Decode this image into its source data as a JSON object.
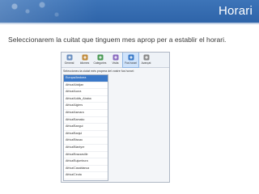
{
  "slide": {
    "title": "Horari",
    "subtitle": "Seleccionarem la cuitat que tinguem mes aprop per a establir el horari."
  },
  "screenshot": {
    "toolbar": {
      "buttons": [
        {
          "label": "General",
          "icon": "general-icon",
          "color": "#6a8fc0"
        },
        {
          "label": "Idiomes",
          "icon": "languages-icon",
          "color": "#c08a3a"
        },
        {
          "label": "Categories",
          "icon": "categories-icon",
          "color": "#4a9a55"
        },
        {
          "label": "Visita",
          "icon": "visit-icon",
          "color": "#8a6ac0"
        },
        {
          "label": "Fus horari",
          "icon": "timezone-icon",
          "color": "#3a7ac8",
          "selected": true
        },
        {
          "label": "Avançat",
          "icon": "advanced-icon",
          "color": "#888888"
        }
      ]
    },
    "prompt": "Seleccioneu la ciutat més propera del vostre fus horari:",
    "cities": [
      "Europa/Andorra",
      "Africa/Abidjan",
      "Africa/Accra",
      "Africa/Addis_Ababa",
      "Africa/Algiers",
      "Africa/Asmara",
      "Africa/Bamako",
      "Africa/Bangui",
      "Africa/Banjul",
      "Africa/Bissau",
      "Africa/Blantyre",
      "Africa/Brazzaville",
      "Africa/Bujumbura",
      "Africa/Casablanca",
      "Africa/Ceuta",
      "Africa/Conakry"
    ],
    "selected_city_index": 0
  }
}
